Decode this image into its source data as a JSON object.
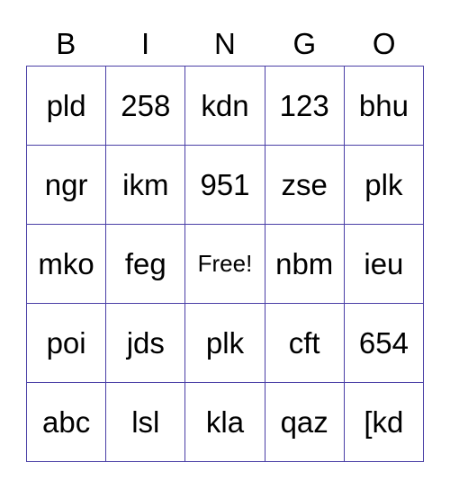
{
  "header": {
    "letters": [
      "B",
      "I",
      "N",
      "G",
      "O"
    ]
  },
  "board": {
    "rows": [
      [
        "pld",
        "258",
        "kdn",
        "123",
        "bhu"
      ],
      [
        "ngr",
        "ikm",
        "951",
        "zse",
        "plk"
      ],
      [
        "mko",
        "feg",
        "Free!",
        "nbm",
        "ieu"
      ],
      [
        "poi",
        "jds",
        "plk",
        "cft",
        "654"
      ],
      [
        "abc",
        "lsl",
        "kla",
        "qaz",
        "[kd"
      ]
    ],
    "free_label": "Free!"
  },
  "colors": {
    "grid_line": "#4a3fa6",
    "text": "#000000",
    "background": "#ffffff"
  }
}
